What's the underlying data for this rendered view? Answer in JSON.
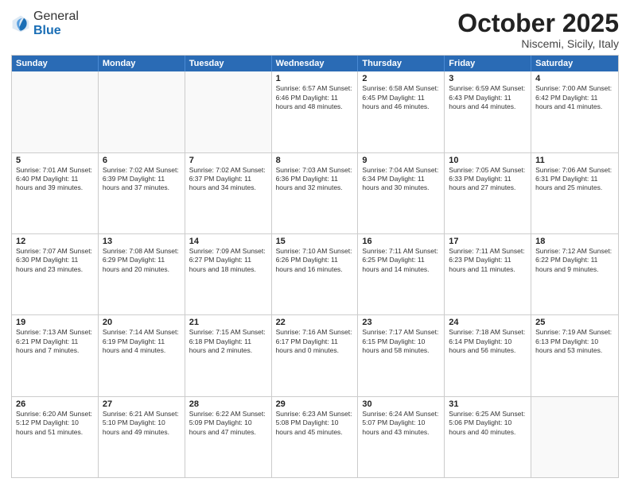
{
  "header": {
    "logo_general": "General",
    "logo_blue": "Blue",
    "month": "October 2025",
    "location": "Niscemi, Sicily, Italy"
  },
  "weekdays": [
    "Sunday",
    "Monday",
    "Tuesday",
    "Wednesday",
    "Thursday",
    "Friday",
    "Saturday"
  ],
  "rows": [
    [
      {
        "day": "",
        "info": ""
      },
      {
        "day": "",
        "info": ""
      },
      {
        "day": "",
        "info": ""
      },
      {
        "day": "1",
        "info": "Sunrise: 6:57 AM\nSunset: 6:46 PM\nDaylight: 11 hours\nand 48 minutes."
      },
      {
        "day": "2",
        "info": "Sunrise: 6:58 AM\nSunset: 6:45 PM\nDaylight: 11 hours\nand 46 minutes."
      },
      {
        "day": "3",
        "info": "Sunrise: 6:59 AM\nSunset: 6:43 PM\nDaylight: 11 hours\nand 44 minutes."
      },
      {
        "day": "4",
        "info": "Sunrise: 7:00 AM\nSunset: 6:42 PM\nDaylight: 11 hours\nand 41 minutes."
      }
    ],
    [
      {
        "day": "5",
        "info": "Sunrise: 7:01 AM\nSunset: 6:40 PM\nDaylight: 11 hours\nand 39 minutes."
      },
      {
        "day": "6",
        "info": "Sunrise: 7:02 AM\nSunset: 6:39 PM\nDaylight: 11 hours\nand 37 minutes."
      },
      {
        "day": "7",
        "info": "Sunrise: 7:02 AM\nSunset: 6:37 PM\nDaylight: 11 hours\nand 34 minutes."
      },
      {
        "day": "8",
        "info": "Sunrise: 7:03 AM\nSunset: 6:36 PM\nDaylight: 11 hours\nand 32 minutes."
      },
      {
        "day": "9",
        "info": "Sunrise: 7:04 AM\nSunset: 6:34 PM\nDaylight: 11 hours\nand 30 minutes."
      },
      {
        "day": "10",
        "info": "Sunrise: 7:05 AM\nSunset: 6:33 PM\nDaylight: 11 hours\nand 27 minutes."
      },
      {
        "day": "11",
        "info": "Sunrise: 7:06 AM\nSunset: 6:31 PM\nDaylight: 11 hours\nand 25 minutes."
      }
    ],
    [
      {
        "day": "12",
        "info": "Sunrise: 7:07 AM\nSunset: 6:30 PM\nDaylight: 11 hours\nand 23 minutes."
      },
      {
        "day": "13",
        "info": "Sunrise: 7:08 AM\nSunset: 6:29 PM\nDaylight: 11 hours\nand 20 minutes."
      },
      {
        "day": "14",
        "info": "Sunrise: 7:09 AM\nSunset: 6:27 PM\nDaylight: 11 hours\nand 18 minutes."
      },
      {
        "day": "15",
        "info": "Sunrise: 7:10 AM\nSunset: 6:26 PM\nDaylight: 11 hours\nand 16 minutes."
      },
      {
        "day": "16",
        "info": "Sunrise: 7:11 AM\nSunset: 6:25 PM\nDaylight: 11 hours\nand 14 minutes."
      },
      {
        "day": "17",
        "info": "Sunrise: 7:11 AM\nSunset: 6:23 PM\nDaylight: 11 hours\nand 11 minutes."
      },
      {
        "day": "18",
        "info": "Sunrise: 7:12 AM\nSunset: 6:22 PM\nDaylight: 11 hours\nand 9 minutes."
      }
    ],
    [
      {
        "day": "19",
        "info": "Sunrise: 7:13 AM\nSunset: 6:21 PM\nDaylight: 11 hours\nand 7 minutes."
      },
      {
        "day": "20",
        "info": "Sunrise: 7:14 AM\nSunset: 6:19 PM\nDaylight: 11 hours\nand 4 minutes."
      },
      {
        "day": "21",
        "info": "Sunrise: 7:15 AM\nSunset: 6:18 PM\nDaylight: 11 hours\nand 2 minutes."
      },
      {
        "day": "22",
        "info": "Sunrise: 7:16 AM\nSunset: 6:17 PM\nDaylight: 11 hours\nand 0 minutes."
      },
      {
        "day": "23",
        "info": "Sunrise: 7:17 AM\nSunset: 6:15 PM\nDaylight: 10 hours\nand 58 minutes."
      },
      {
        "day": "24",
        "info": "Sunrise: 7:18 AM\nSunset: 6:14 PM\nDaylight: 10 hours\nand 56 minutes."
      },
      {
        "day": "25",
        "info": "Sunrise: 7:19 AM\nSunset: 6:13 PM\nDaylight: 10 hours\nand 53 minutes."
      }
    ],
    [
      {
        "day": "26",
        "info": "Sunrise: 6:20 AM\nSunset: 5:12 PM\nDaylight: 10 hours\nand 51 minutes."
      },
      {
        "day": "27",
        "info": "Sunrise: 6:21 AM\nSunset: 5:10 PM\nDaylight: 10 hours\nand 49 minutes."
      },
      {
        "day": "28",
        "info": "Sunrise: 6:22 AM\nSunset: 5:09 PM\nDaylight: 10 hours\nand 47 minutes."
      },
      {
        "day": "29",
        "info": "Sunrise: 6:23 AM\nSunset: 5:08 PM\nDaylight: 10 hours\nand 45 minutes."
      },
      {
        "day": "30",
        "info": "Sunrise: 6:24 AM\nSunset: 5:07 PM\nDaylight: 10 hours\nand 43 minutes."
      },
      {
        "day": "31",
        "info": "Sunrise: 6:25 AM\nSunset: 5:06 PM\nDaylight: 10 hours\nand 40 minutes."
      },
      {
        "day": "",
        "info": ""
      }
    ]
  ]
}
